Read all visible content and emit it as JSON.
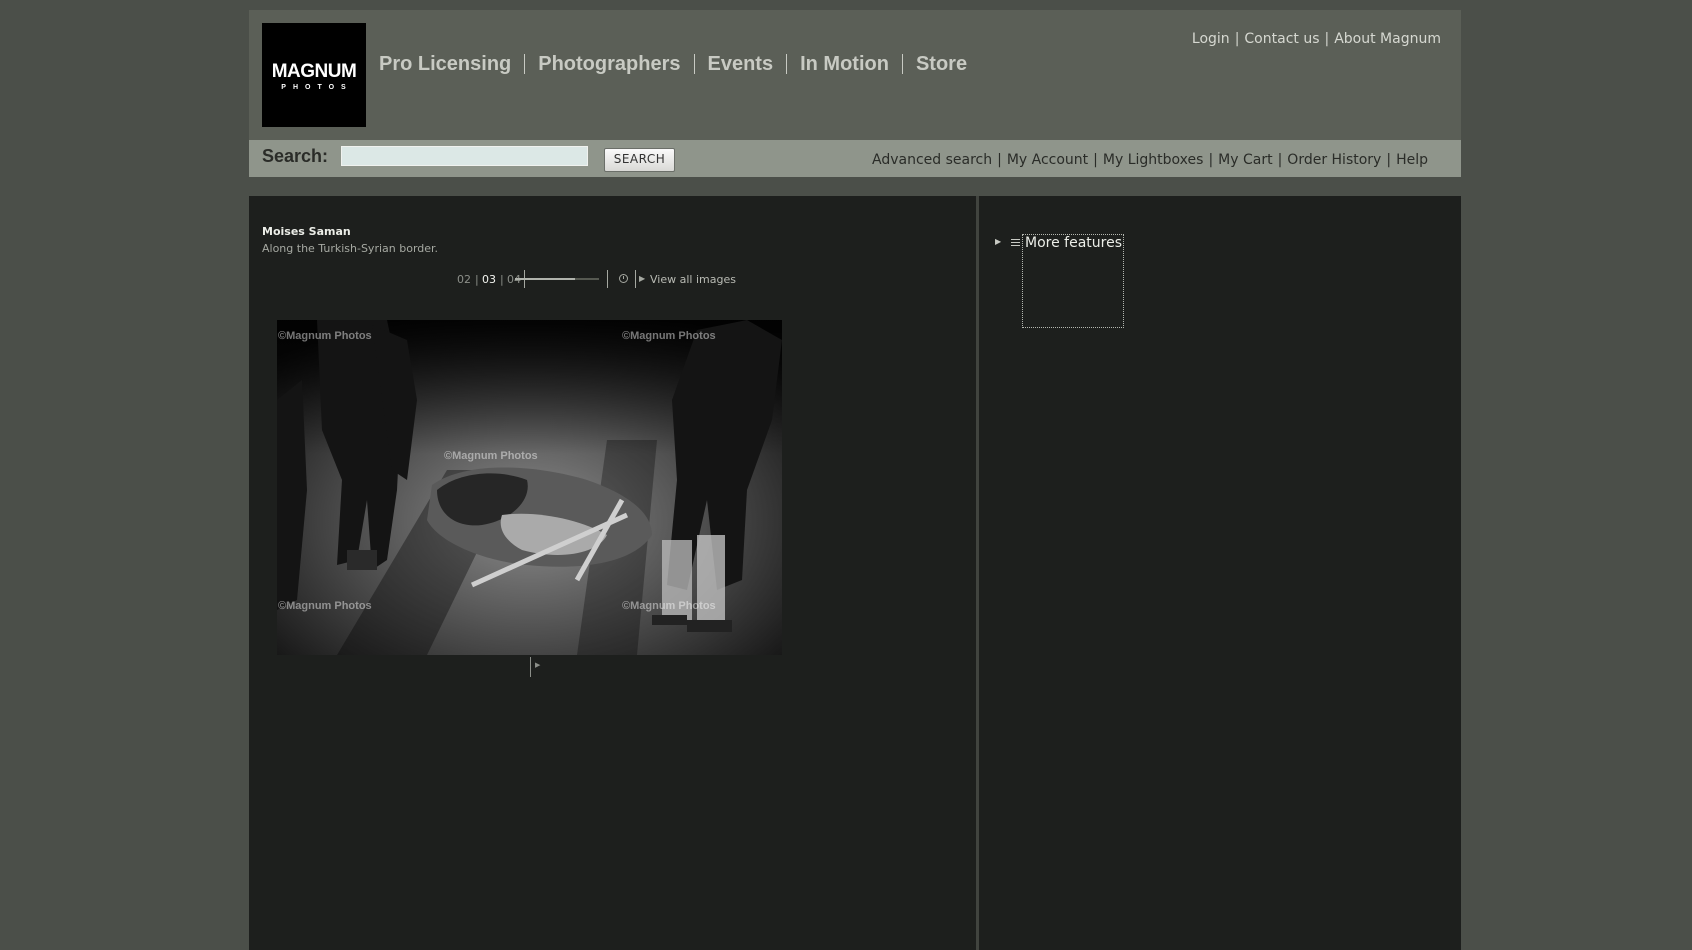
{
  "logo": {
    "line1": "MAGNUM",
    "line2": "PHOTOS"
  },
  "main_nav": [
    "Pro Licensing",
    "Photographers",
    "Events",
    "In Motion",
    "Store"
  ],
  "top_nav": [
    "Login",
    "Contact us",
    "About Magnum"
  ],
  "search": {
    "label": "Search:",
    "value": "",
    "placeholder": "",
    "button": "SEARCH"
  },
  "sub_nav": [
    "Advanced search",
    "My Account",
    "My Lightboxes",
    "My Cart",
    "Order History",
    "Help"
  ],
  "story": {
    "photographer": "Moises Saman",
    "caption": "Along the Turkish-Syrian border."
  },
  "pager": {
    "prev": "02",
    "current": "03",
    "next": "04",
    "sep": "|",
    "view_all": "View all images",
    "progress": 0.72
  },
  "photo": {
    "watermark": "©Magnum Photos"
  },
  "sidebar": {
    "more_features": "More features"
  },
  "colors": {
    "page_bg": "#4b4f49",
    "header_bg": "#5b5f57",
    "search_bar_bg": "#8f958b",
    "content_bg": "#1d1f1d"
  },
  "icons": {
    "pager_clock": "clock-icon",
    "view_all": "play-triangle-icon",
    "more_features": "list-icon"
  }
}
